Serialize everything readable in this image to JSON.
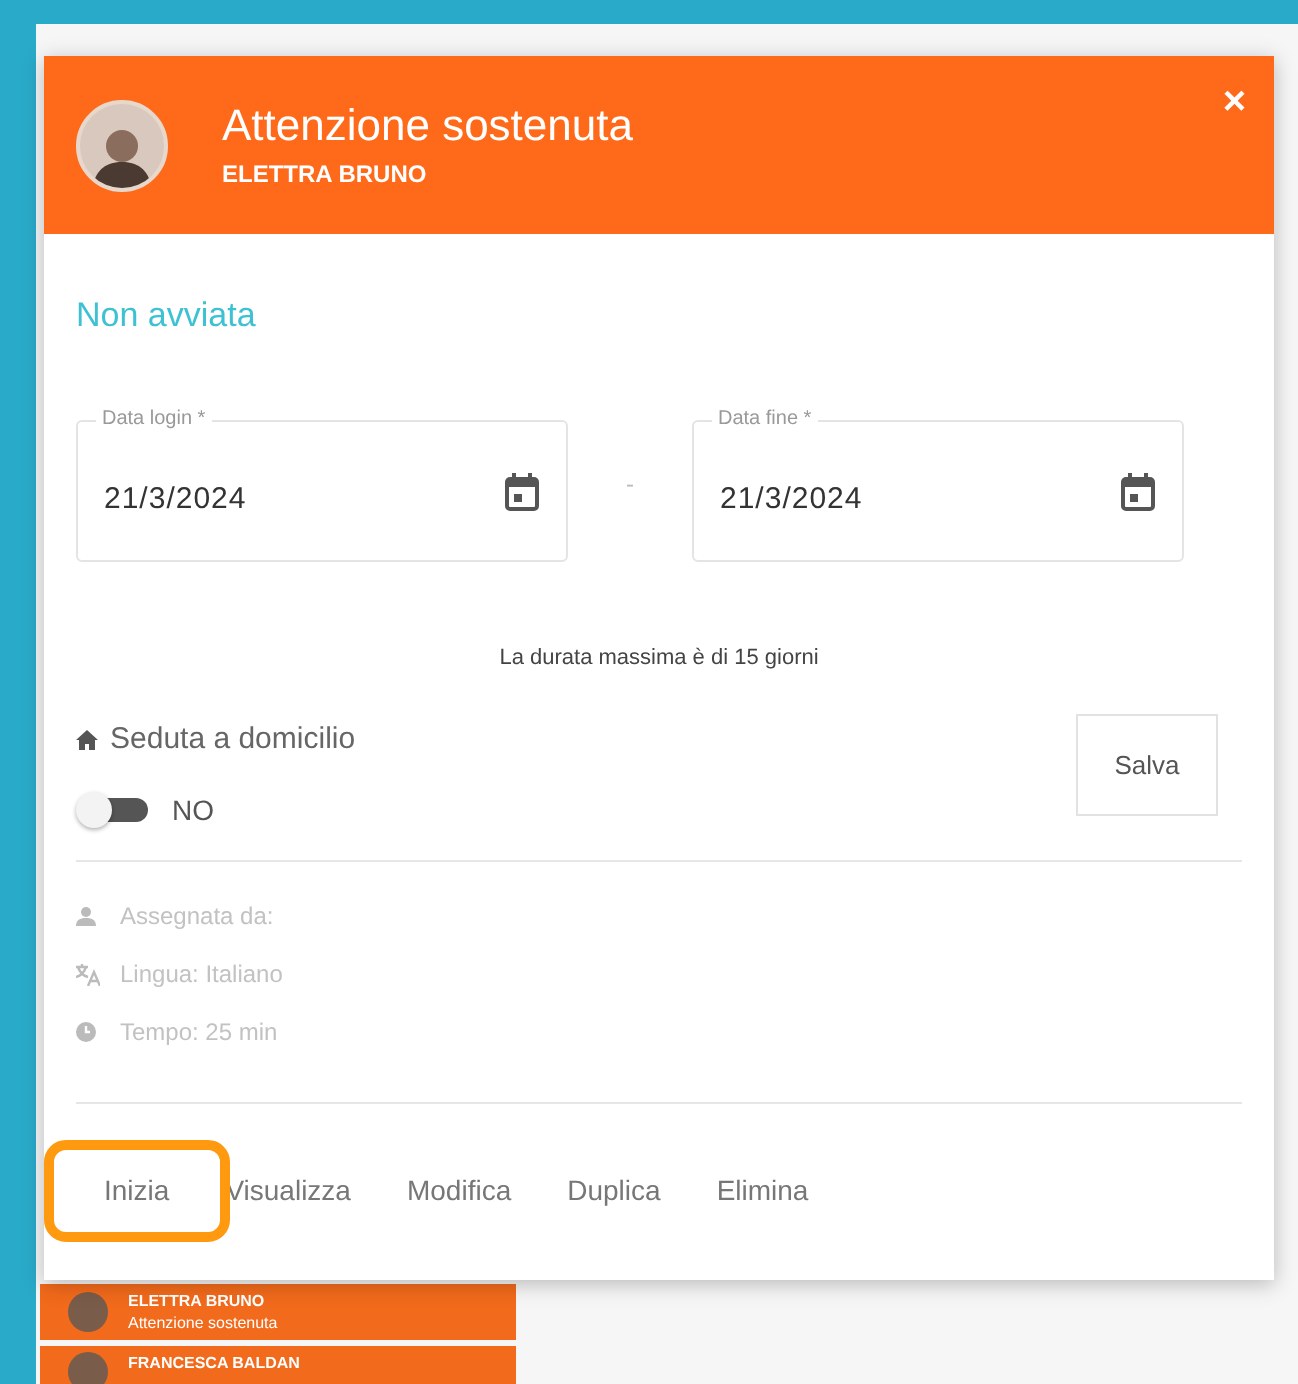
{
  "dialog": {
    "title": "Attenzione sostenuta",
    "subtitle": "ELETTRA BRUNO",
    "close": "×"
  },
  "status": "Non avviata",
  "fields": [
    {
      "label": "Data login *",
      "value": "21/3/2024"
    },
    {
      "label": "Data fine *",
      "value": "21/3/2024"
    }
  ],
  "range_separator": "-",
  "note": "La durata massima è di 15 giorni",
  "home_visit": {
    "label": "Seduta a domicilio",
    "on": false,
    "state_text": "NO"
  },
  "save_button": "Salva",
  "info": [
    {
      "kind": "user",
      "text": "Assegnata da:"
    },
    {
      "kind": "language",
      "text": "Lingua: Italiano"
    },
    {
      "kind": "clock",
      "text": "Tempo: 25 min"
    }
  ],
  "actions": [
    {
      "label": "Inizia",
      "highlighted": true
    },
    {
      "label": "Visualizza",
      "highlighted": false
    },
    {
      "label": "Modifica",
      "highlighted": false
    },
    {
      "label": "Duplica",
      "highlighted": false
    },
    {
      "label": "Elimina",
      "highlighted": false
    }
  ],
  "background_events": [
    {
      "name": "ELETTRA BRUNO",
      "activity": "Attenzione sostenuta",
      "color": "#f26a1b"
    },
    {
      "name": "FRANCESCA BALDAN",
      "color": "#f26a1b"
    }
  ]
}
